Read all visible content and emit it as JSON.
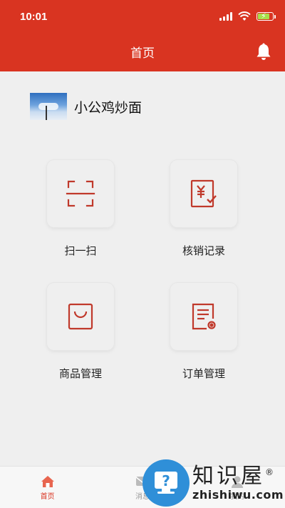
{
  "status_bar": {
    "time": "10:01"
  },
  "nav": {
    "title": "首页",
    "bell_icon": "bell-icon"
  },
  "shop": {
    "name": "小公鸡炒面"
  },
  "colors": {
    "brand": "#d93421",
    "icon_red": "#c0392b"
  },
  "grid": [
    {
      "label": "扫一扫",
      "icon": "scan-icon"
    },
    {
      "label": "核销记录",
      "icon": "verification-record-icon"
    },
    {
      "label": "商品管理",
      "icon": "product-icon"
    },
    {
      "label": "订单管理",
      "icon": "order-settings-icon"
    }
  ],
  "tabbar": [
    {
      "label": "首页",
      "icon": "home-icon",
      "active": true
    },
    {
      "label": "消息",
      "icon": "message-icon",
      "active": false
    },
    {
      "label": "我的",
      "icon": "user-icon",
      "active": false
    }
  ],
  "watermark": {
    "cn": "知识屋",
    "en": "zhishiwu.com",
    "reg": "®"
  }
}
